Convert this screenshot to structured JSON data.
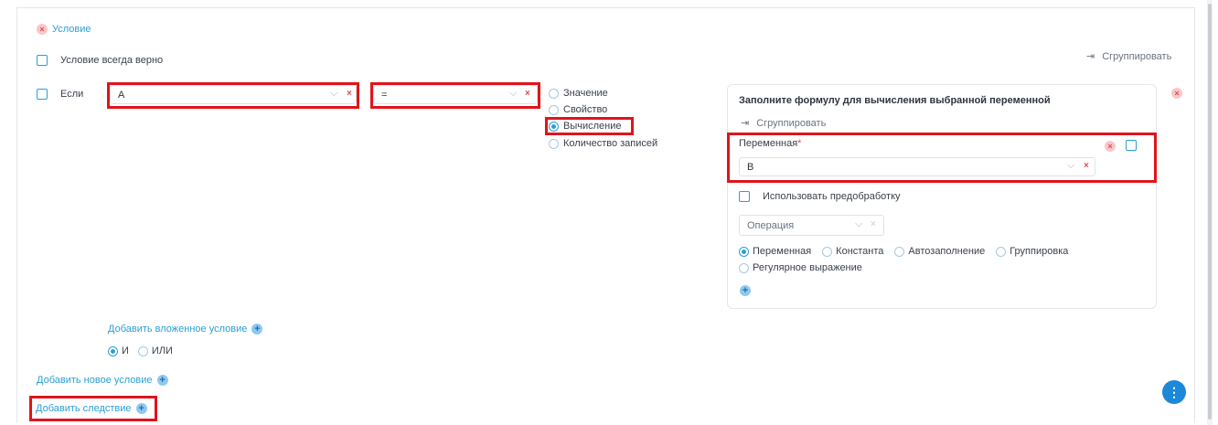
{
  "condition_header": {
    "label": "Условие"
  },
  "always_true": {
    "label": "Условие всегда верно",
    "checked": false
  },
  "group_button": {
    "label": "Сгруппировать",
    "icon": "indent-icon"
  },
  "if_row": {
    "label": "Если",
    "field_select": {
      "value": "A"
    },
    "operator_select": {
      "value": "="
    },
    "value_types": [
      "Значение",
      "Свойство",
      "Вычисление",
      "Количество записей"
    ],
    "selected_value_type": "Вычисление"
  },
  "formula_panel": {
    "title": "Заполните формулу для вычисления выбранной переменной",
    "group_label": "Сгруппировать",
    "variable_label": "Переменная",
    "required_mark": "*",
    "variable_value": "B",
    "preprocess_label": "Использовать предобработку",
    "operation_placeholder": "Операция",
    "source_options": [
      "Переменная",
      "Константа",
      "Автозаполнение",
      "Группировка",
      "Регулярное выражение"
    ],
    "selected_source": "Переменная"
  },
  "nested": {
    "add_label": "Добавить вложенное условие",
    "logic_options": [
      "И",
      "ИЛИ"
    ],
    "selected_logic": "И"
  },
  "add_condition_label": "Добавить новое условие",
  "add_consequence_label": "Добавить следствие",
  "colors": {
    "accent": "#2a9fd6",
    "danger": "#e24a4a",
    "highlight": "#e0141b",
    "fab": "#1e88d8"
  }
}
